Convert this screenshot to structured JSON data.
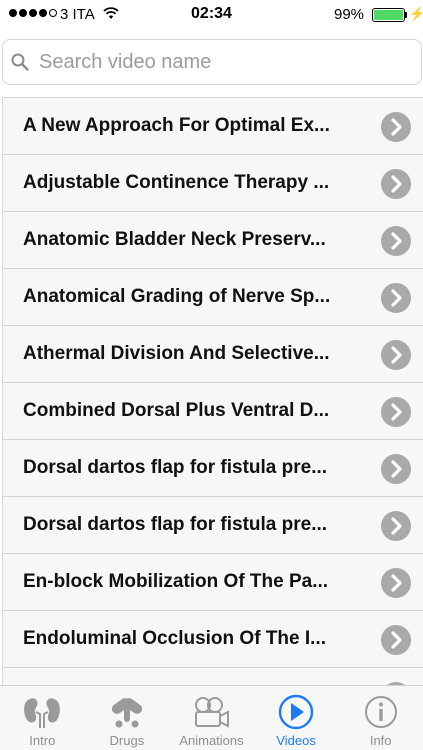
{
  "status_bar": {
    "carrier": "3 ITA",
    "time": "02:34",
    "battery_percent": "99%",
    "signal_bars_filled": 4,
    "signal_bars_total": 5
  },
  "search": {
    "placeholder": "Search video name",
    "value": ""
  },
  "videos": [
    {
      "title": "A New Approach For Optimal Ex..."
    },
    {
      "title": "Adjustable Continence Therapy ..."
    },
    {
      "title": "Anatomic Bladder Neck Preserv..."
    },
    {
      "title": "Anatomical Grading of Nerve Sp..."
    },
    {
      "title": "Athermal Division And Selective..."
    },
    {
      "title": "Combined Dorsal Plus Ventral D..."
    },
    {
      "title": "Dorsal dartos flap for fistula pre..."
    },
    {
      "title": "Dorsal dartos flap for fistula pre..."
    },
    {
      "title": "En-block Mobilization Of The Pa..."
    },
    {
      "title": "Endoluminal Occlusion Of The I..."
    },
    {
      "title": ""
    }
  ],
  "tabs": [
    {
      "label": "Intro",
      "icon": "kidneys-icon",
      "active": false
    },
    {
      "label": "Drugs",
      "icon": "pills-icon",
      "active": false
    },
    {
      "label": "Animations",
      "icon": "film-camera-icon",
      "active": false
    },
    {
      "label": "Videos",
      "icon": "play-icon",
      "active": true
    },
    {
      "label": "Info",
      "icon": "info-icon",
      "active": false
    }
  ],
  "colors": {
    "accent": "#1a7cf5",
    "inactive_tab": "#8e8e8e",
    "chevron": "#a9a9a9",
    "battery": "#4cd964"
  }
}
